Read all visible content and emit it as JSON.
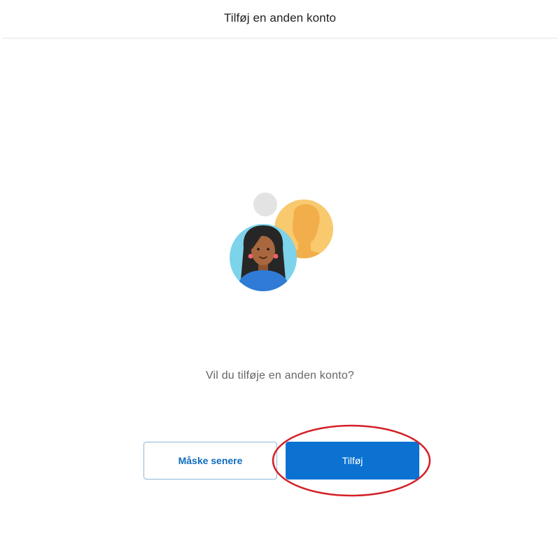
{
  "header": {
    "title": "Tilføj en anden konto"
  },
  "illustration": {
    "icon": "add-account-avatars-illustration",
    "colors": {
      "woman_bg": "#7dd3ea",
      "person_bg": "#f9c96e",
      "small_dot": "#e3e3e3",
      "shirt": "#2f7bd6",
      "skin": "#a9673f"
    }
  },
  "main": {
    "prompt": "Vil du tilføje en anden konto?"
  },
  "actions": {
    "later_label": "Måske senere",
    "add_label": "Tilføj"
  },
  "colors": {
    "accent": "#0b72d2",
    "annotation": "#d42027"
  }
}
